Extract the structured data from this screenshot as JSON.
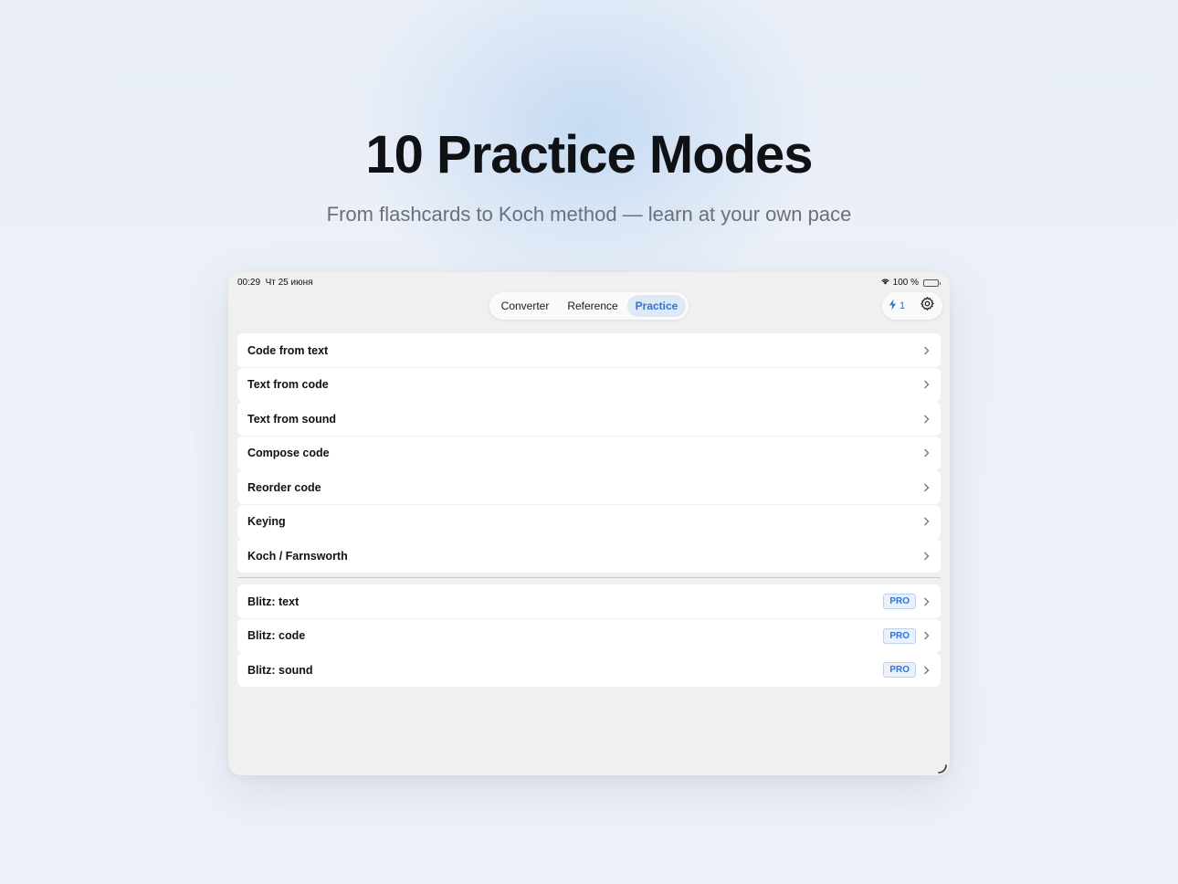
{
  "hero": {
    "title": "10 Practice Modes",
    "subtitle": "From flashcards to Koch method — learn at your own pace"
  },
  "status_bar": {
    "time": "00:29",
    "date": "Чт 25 июня",
    "battery": "100 %"
  },
  "tabs": [
    {
      "label": "Converter",
      "active": false
    },
    {
      "label": "Reference",
      "active": false
    },
    {
      "label": "Practice",
      "active": true
    }
  ],
  "toolbar": {
    "streak_count": "1"
  },
  "practice_modes": [
    {
      "label": "Code from text"
    },
    {
      "label": "Text from code"
    },
    {
      "label": "Text from sound"
    },
    {
      "label": "Compose code"
    },
    {
      "label": "Reorder code"
    },
    {
      "label": "Keying"
    },
    {
      "label": "Koch / Farnsworth"
    }
  ],
  "blitz_modes": [
    {
      "label": "Blitz: text",
      "badge": "PRO"
    },
    {
      "label": "Blitz: code",
      "badge": "PRO"
    },
    {
      "label": "Blitz: sound",
      "badge": "PRO"
    }
  ],
  "colors": {
    "accent": "#2b75d6",
    "active_tab_bg": "#dde9f7"
  }
}
